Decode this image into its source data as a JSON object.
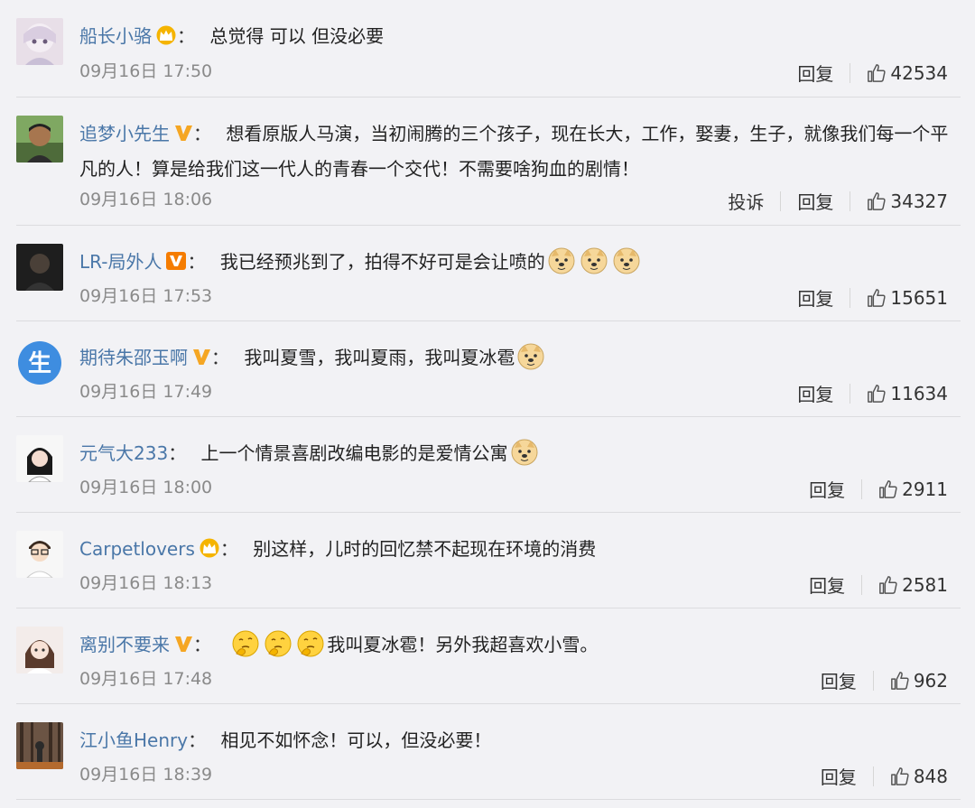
{
  "comments": [
    {
      "user": "船长小骆",
      "badge": "crown-icon",
      "text1": "总觉得 可以 但没必要",
      "text2": "",
      "time": "09月16日 17:50",
      "report": "",
      "reply": "回复",
      "likes": "42534",
      "emojis": []
    },
    {
      "user": "追梦小先生",
      "badge": "vip-v-icon",
      "text1": "想看原版人马演，当初闹腾的三个孩子，现在长大，工作，娶妻，生子，就像我们每一个平",
      "text2": "凡的人！算是给我们这一代人的青春一个交代！不需要啥狗血的剧情！",
      "time": "09月16日 18:06",
      "report": "投诉",
      "reply": "回复",
      "likes": "34327",
      "emojis": []
    },
    {
      "user": "LR-局外人",
      "badge": "vip-box-v-icon",
      "text1": "我已经预兆到了，拍得不好可是会让喷的",
      "text2": "",
      "time": "09月16日 17:53",
      "report": "",
      "reply": "回复",
      "likes": "15651",
      "emojis": [
        "doge",
        "doge",
        "doge"
      ]
    },
    {
      "user": "期待朱邵玉啊",
      "badge": "vip-v-icon",
      "text1": "我叫夏雪，我叫夏雨，我叫夏冰雹",
      "text2": "",
      "time": "09月16日 17:49",
      "report": "",
      "reply": "回复",
      "likes": "11634",
      "emojis": [
        "doge"
      ]
    },
    {
      "user": "元气大233",
      "badge": "",
      "text1": "上一个情景喜剧改编电影的是爱情公寓",
      "text2": "",
      "time": "09月16日 18:00",
      "report": "",
      "reply": "回复",
      "likes": "2911",
      "emojis": [
        "doge"
      ]
    },
    {
      "user": "Carpetlovers",
      "badge": "crown-icon",
      "text1": "别这样，儿时的回忆禁不起现在环境的消费",
      "text2": "",
      "time": "09月16日 18:13",
      "report": "",
      "reply": "回复",
      "likes": "2581",
      "emojis": []
    },
    {
      "user": "离别不要来",
      "badge": "vip-v-icon",
      "text1": "我叫夏冰雹！另外我超喜欢小雪。",
      "text2": "",
      "time": "09月16日 17:48",
      "report": "",
      "reply": "回复",
      "likes": "962",
      "emojis": [
        "think",
        "think",
        "think"
      ]
    },
    {
      "user": "江小鱼Henry",
      "badge": "",
      "text1": "相见不如怀念！可以，但没必要！",
      "text2": "",
      "time": "09月16日 18:39",
      "report": "",
      "reply": "回复",
      "likes": "848",
      "emojis": []
    }
  ]
}
